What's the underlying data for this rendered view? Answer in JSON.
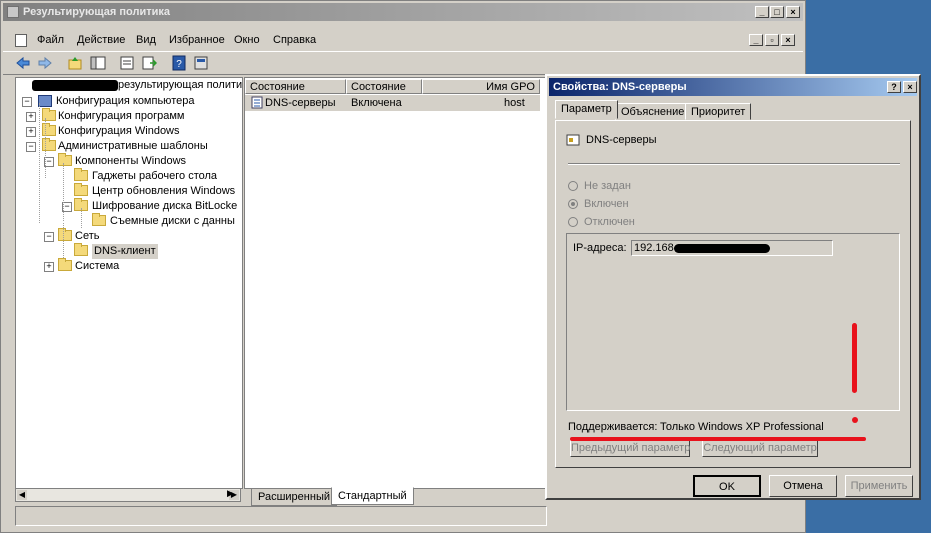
{
  "main_window": {
    "title": "Результирующая политика",
    "menu": [
      "Файл",
      "Действие",
      "Вид",
      "Избранное",
      "Окно",
      "Справка"
    ],
    "title_buttons": [
      "_",
      "□",
      "×"
    ],
    "child_buttons": [
      "_",
      "▫",
      "×"
    ]
  },
  "tree": {
    "root_label": "результирующая полити",
    "items": [
      {
        "label": "Конфигурация компьютера",
        "expander": "−"
      },
      {
        "label": "Конфигурация программ",
        "expander": "+"
      },
      {
        "label": "Конфигурация Windows",
        "expander": "+"
      },
      {
        "label": "Административные шаблоны",
        "expander": "−"
      },
      {
        "label": "Компоненты Windows",
        "expander": "−"
      },
      {
        "label": "Гаджеты рабочего стола",
        "expander": ""
      },
      {
        "label": "Центр обновления Windows",
        "expander": ""
      },
      {
        "label": "Шифрование диска BitLocke",
        "expander": "−"
      },
      {
        "label": "Съемные диски с данны",
        "expander": ""
      },
      {
        "label": "Сеть",
        "expander": "−"
      },
      {
        "label": "DNS-клиент",
        "expander": ""
      },
      {
        "label": "Система",
        "expander": "+"
      }
    ]
  },
  "list": {
    "columns": [
      "Состояние",
      "Состояние",
      "Имя GPO"
    ],
    "rows": [
      {
        "name": "DNS-серверы",
        "state": "Включена",
        "gpo": "host"
      }
    ]
  },
  "bottom_tabs": [
    "Расширенный",
    "Стандартный"
  ],
  "dialog": {
    "title": "Свойства: DNS-серверы",
    "title_buttons": [
      "?",
      "×"
    ],
    "tabs": [
      "Параметр",
      "Объяснение",
      "Приоритет"
    ],
    "policy_name": "DNS-серверы",
    "radios": [
      "Не задан",
      "Включен",
      "Отключен"
    ],
    "selected_radio": "Включен",
    "ip_label": "IP-адреса:",
    "ip_value": "192.168",
    "supported_label": "Поддерживается:",
    "supported_value": "Только Windows XP Professional",
    "prev_button": "Предыдущий параметр",
    "next_button": "Следующий параметр",
    "ok_button": "OK",
    "cancel_button": "Отмена",
    "apply_button": "Применить"
  },
  "colors": {
    "dialog_title_start": "#0a246a",
    "dialog_title_end": "#a6caf0",
    "annotation_red": "#e8121c",
    "selection_gray": "#d4d0c8"
  }
}
